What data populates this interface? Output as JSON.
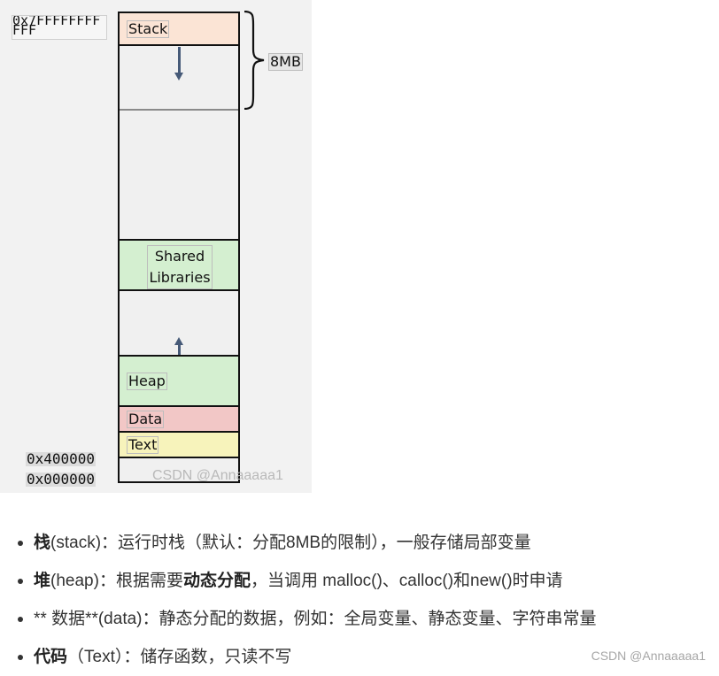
{
  "figure": {
    "addresses": {
      "top": "0x7FFFFFFFFFFF",
      "text_start": "0x400000",
      "bottom": "0x000000"
    },
    "segments": {
      "stack": "Stack",
      "shared": "Shared Libraries",
      "heap": "Heap",
      "data": "Data",
      "text": "Text"
    },
    "stack_size": "8MB",
    "watermark": "CSDN @Annaaaaa1",
    "colors": {
      "stack": "#fbe4d5",
      "shared": "#d4efd0",
      "heap": "#d4efd0",
      "data": "#f2c7c6",
      "text": "#f7f3bb",
      "arrow": "#465a78"
    }
  },
  "bullets": [
    {
      "bold": "栈",
      "text": "(stack)：运行时栈（默认：分配8MB的限制），一般存储局部变量"
    },
    {
      "bold": "堆",
      "text_before": "(heap)：根据需要",
      "bold_mid": "动态分配",
      "text_after": "，当调用 malloc()、calloc()和new()时申请"
    },
    {
      "text": "** 数据**(data)：静态分配的数据，例如：全局变量、静态变量、字符串常量"
    },
    {
      "bold": "代码",
      "text": "（Text）：储存函数，只读不写"
    }
  ],
  "page_watermark": "CSDN @Annaaaaa1"
}
